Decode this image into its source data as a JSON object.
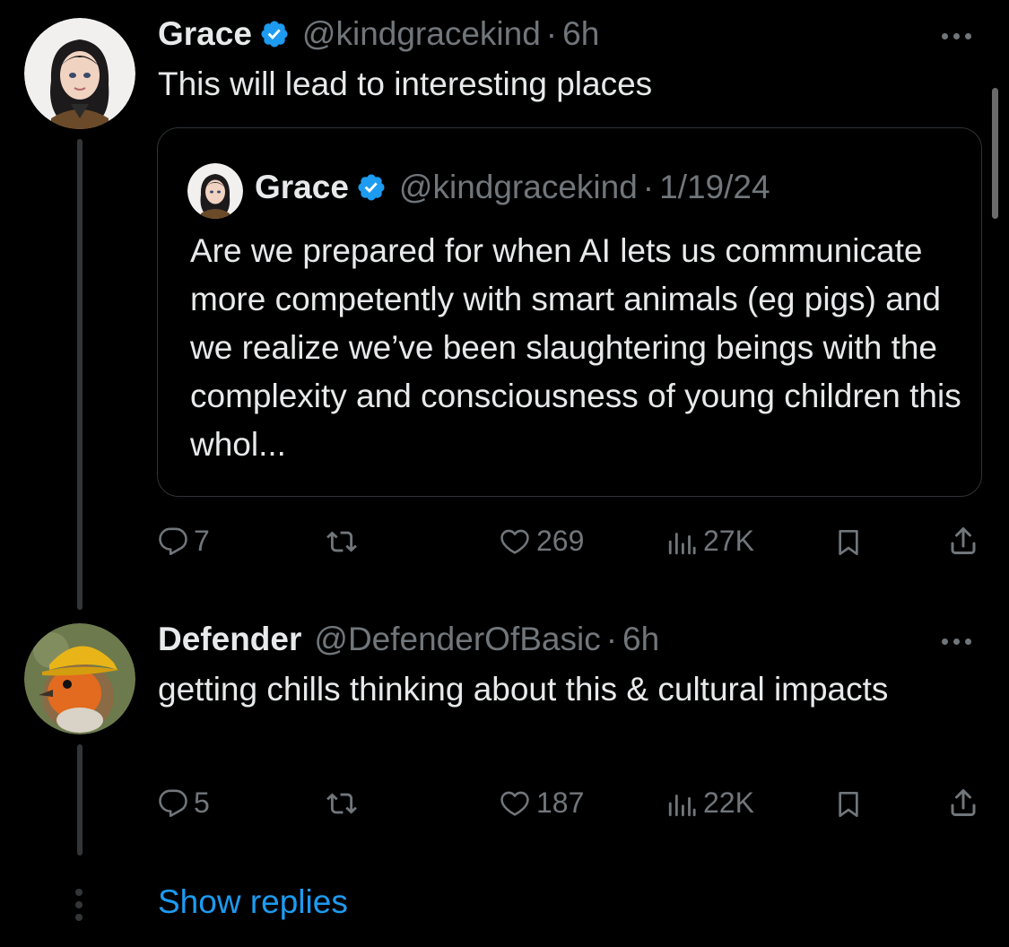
{
  "tweets": [
    {
      "name": "Grace",
      "handle": "@kindgracekind",
      "separator": "·",
      "time": "6h",
      "text": "This will lead to interesting places",
      "quote": {
        "name": "Grace",
        "handle": "@kindgracekind",
        "separator": "·",
        "time": "1/19/24",
        "text": "Are we prepared for when AI lets us communicate more competently with smart animals (eg pigs) and we realize we’ve been slaughtering beings with the complexity and consciousness of young children this whol..."
      },
      "replies": "7",
      "likes": "269",
      "views": "27K"
    },
    {
      "name": "Defender",
      "handle": "@DefenderOfBasic",
      "separator": "·",
      "time": "6h",
      "text": "getting chills thinking about this & cultural impacts",
      "replies": "5",
      "likes": "187",
      "views": "22K"
    }
  ],
  "show_replies_label": "Show replies",
  "colors": {
    "background": "#000000",
    "text": "#e7e9ea",
    "muted": "#71767b",
    "accent": "#1d9bf0",
    "verified": "#1d9bf0"
  },
  "icons": [
    "verified-badge-icon",
    "more-icon",
    "reply-icon",
    "retweet-icon",
    "like-icon",
    "views-icon",
    "bookmark-icon",
    "share-icon"
  ]
}
